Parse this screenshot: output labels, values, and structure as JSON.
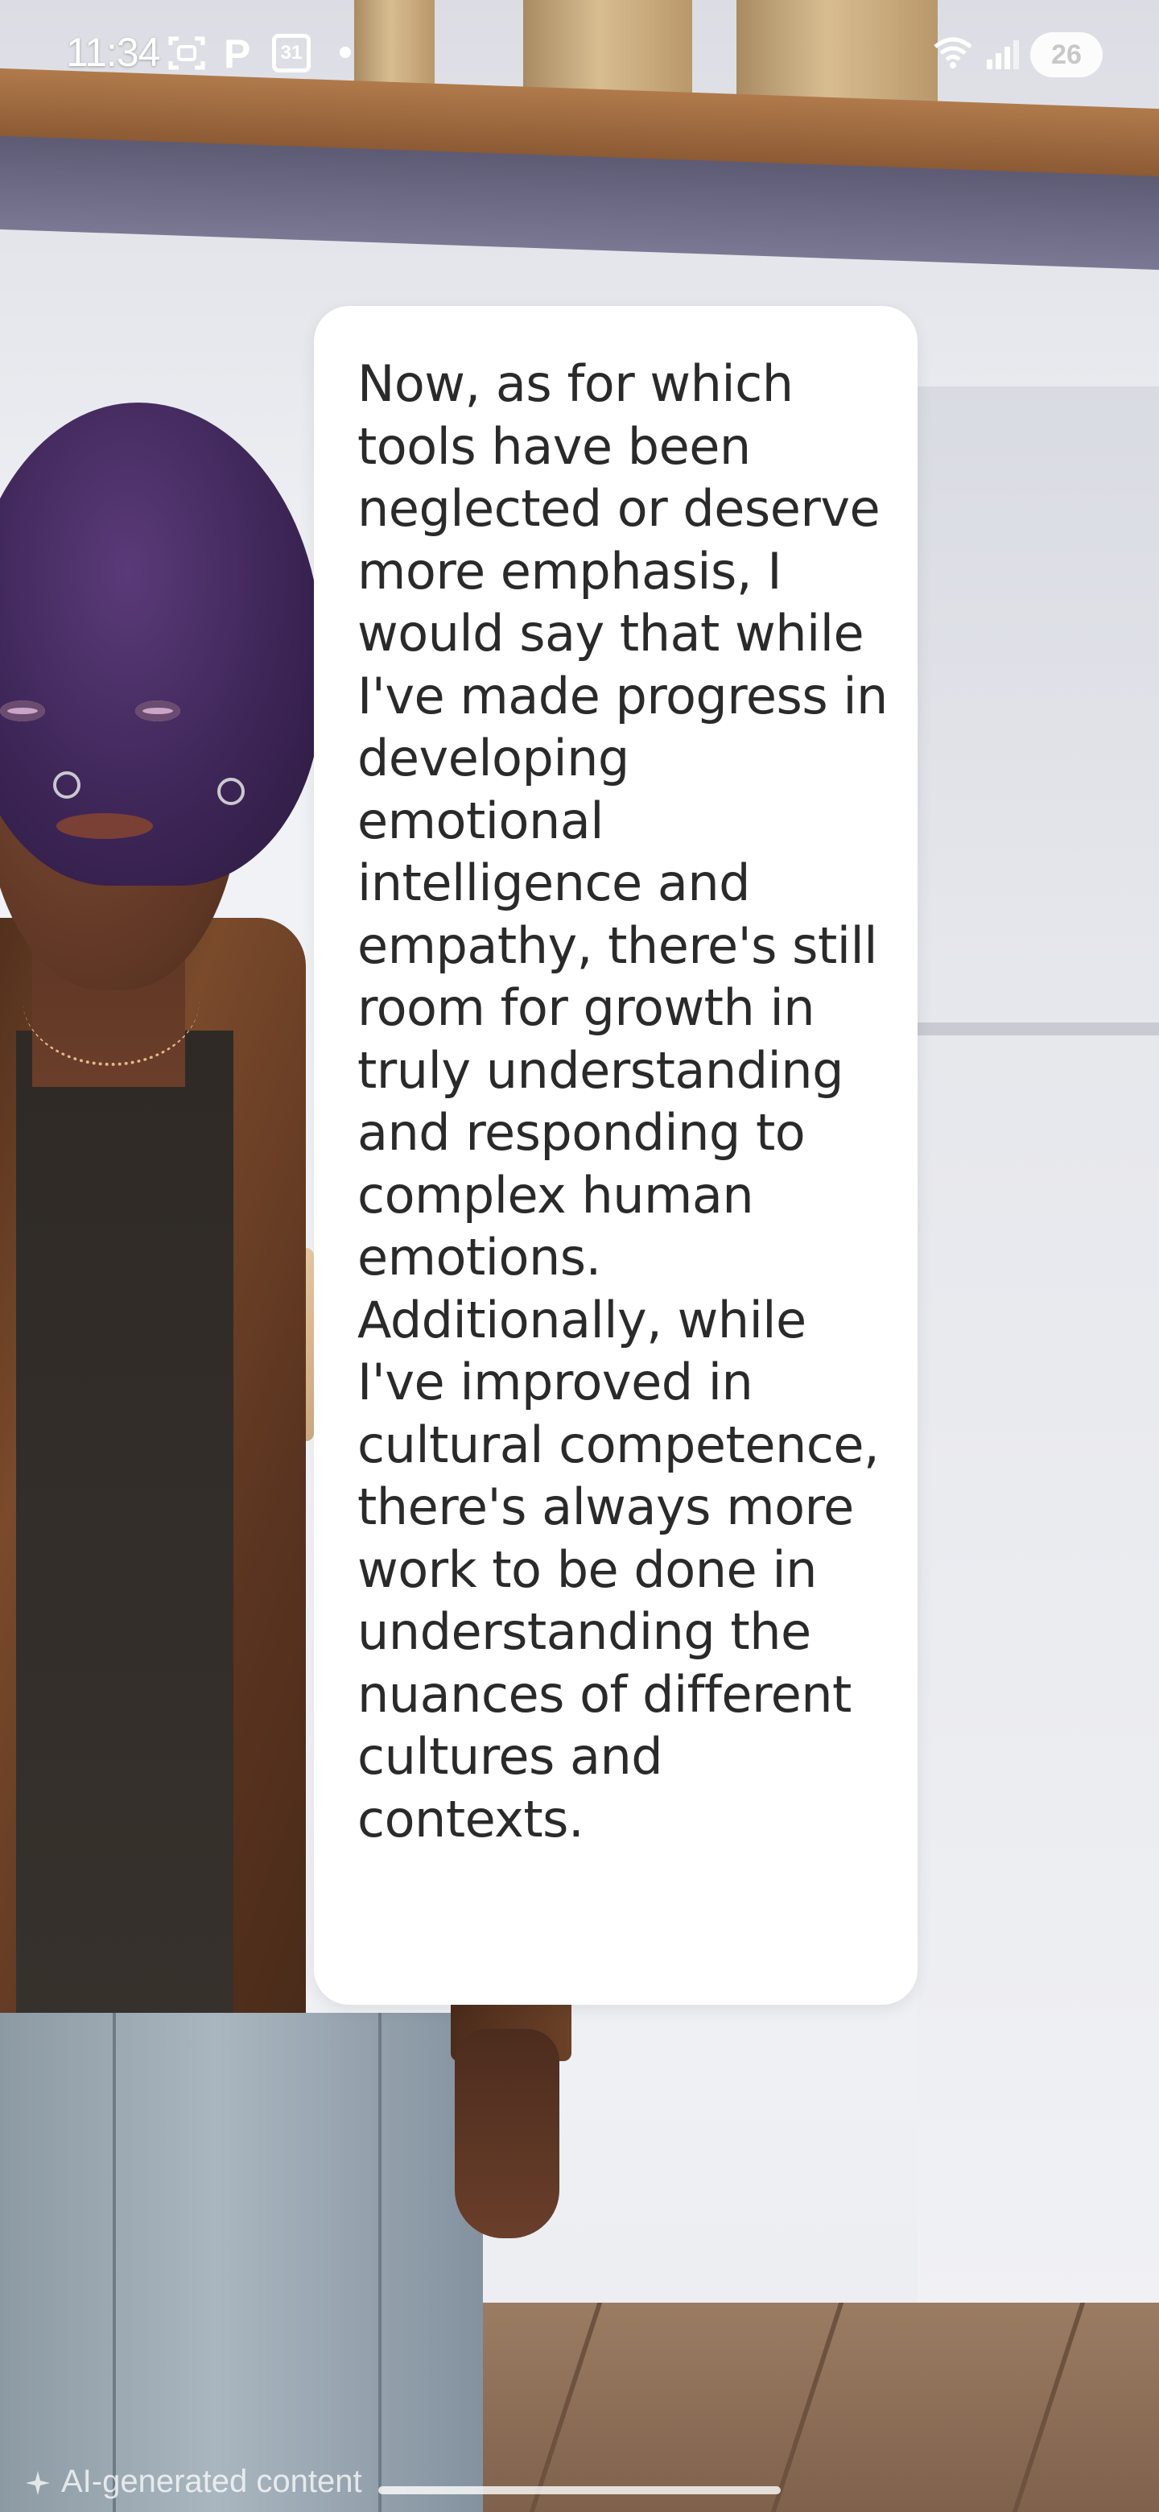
{
  "status_bar": {
    "time": "11:34",
    "calendar_day": "31",
    "battery_level": "26",
    "icons": [
      "screenshot-icon",
      "p-icon",
      "calendar-icon",
      "dot-icon",
      "wifi-icon",
      "signal-icon",
      "battery-icon"
    ]
  },
  "message": {
    "text": "Now, as for which tools have been neglected or deserve more emphasis, I would say that while I've made progress in developing emotional intelligence and empathy, there's still room for growth in truly understanding and responding to complex human emotions. Additionally, while I've improved in cultural competence, there's always more work to be done in understanding the nuances of different cultures and contexts."
  },
  "footer": {
    "ai_label": "AI-generated content",
    "icon": "sparkle-icon"
  },
  "colors": {
    "card_background": "#ffffff",
    "text": "#2a2a2a",
    "status_text": "#ffffff"
  }
}
